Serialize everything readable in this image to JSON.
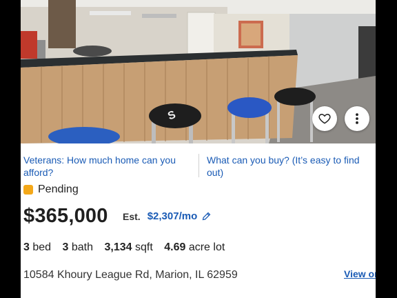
{
  "links": {
    "veterans": "Veterans: How much home can you afford?",
    "buy": "What can you buy? (It’s easy to find out)"
  },
  "status": {
    "label": "Pending",
    "color": "#f4a819"
  },
  "price": "$365,000",
  "estimate": {
    "label": "Est.",
    "amount": "$2,307/mo"
  },
  "facts": {
    "beds_value": "3",
    "beds_label": "bed",
    "baths_value": "3",
    "baths_label": "bath",
    "sqft_value": "3,134",
    "sqft_label": "sqft",
    "lot_value": "4.69",
    "lot_label": "acre lot"
  },
  "address": "10584 Khoury League Rd, Marion, IL 62959",
  "view_on_label": "View or",
  "colors": {
    "link": "#1a5bb5",
    "pending": "#f4a819"
  },
  "icons": [
    "heart-icon",
    "more-vertical-icon",
    "pencil-icon"
  ]
}
